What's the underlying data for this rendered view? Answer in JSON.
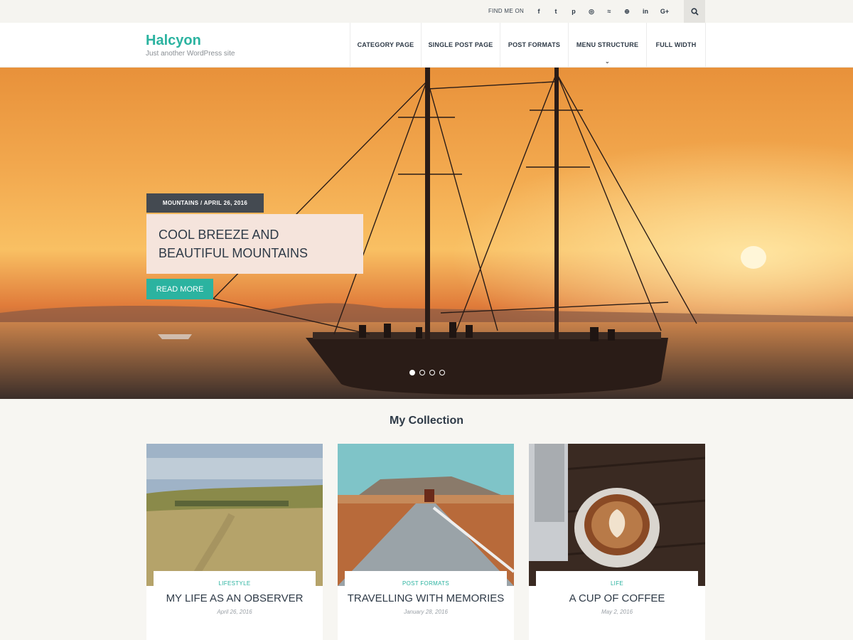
{
  "topbar": {
    "find_me_label": "FIND ME ON",
    "social_icons": [
      "facebook-icon",
      "twitter-icon",
      "pinterest-icon",
      "instagram-icon",
      "rss-icon",
      "dribbble-icon",
      "linkedin-icon",
      "google-plus-icon"
    ],
    "social_glyphs": [
      "f",
      "t",
      "p",
      "◎",
      "≈",
      "⊕",
      "in",
      "G+"
    ],
    "search_icon": "search-icon"
  },
  "header": {
    "site_title": "Halcyon",
    "tagline": "Just another WordPress site",
    "nav": [
      {
        "label": "CATEGORY PAGE"
      },
      {
        "label": "SINGLE POST PAGE"
      },
      {
        "label": "POST FORMATS"
      },
      {
        "label": "MENU STRUCTURE",
        "has_dropdown": true,
        "caret": "⌄"
      },
      {
        "label": "FULL WIDTH"
      }
    ]
  },
  "hero": {
    "meta": "MOUNTAINS / APRIL 26, 2016",
    "title": "COOL BREEZE AND BEAUTIFUL MOUNTAINS",
    "read_more": "READ MORE",
    "slide_count": 4,
    "active_slide": 1
  },
  "collection": {
    "title": "My Collection",
    "cards": [
      {
        "category": "LIFESTYLE",
        "title": "MY LIFE AS AN OBSERVER",
        "date": "April 26, 2016"
      },
      {
        "category": "POST FORMATS",
        "title": "TRAVELLING WITH MEMORIES",
        "date": "January 28, 2016"
      },
      {
        "category": "LIFE",
        "title": "A CUP OF COFFEE",
        "date": "May 2, 2016"
      }
    ]
  },
  "colors": {
    "accent": "#2bb3a0",
    "text": "#2e3a47",
    "meta_bg": "#444a51",
    "title_box_bg": "#f5e4dc"
  }
}
